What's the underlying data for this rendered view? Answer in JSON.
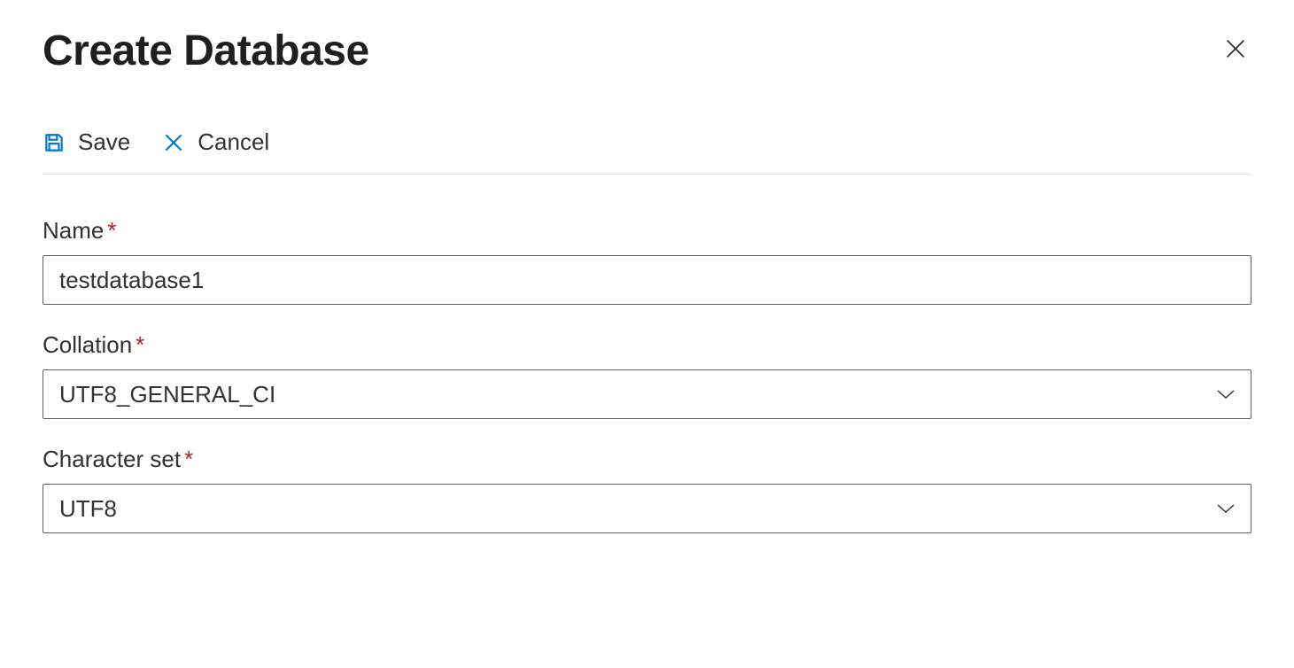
{
  "header": {
    "title": "Create Database"
  },
  "toolbar": {
    "save_label": "Save",
    "cancel_label": "Cancel"
  },
  "form": {
    "name": {
      "label": "Name",
      "value": "testdatabase1"
    },
    "collation": {
      "label": "Collation",
      "value": "UTF8_GENERAL_CI"
    },
    "charset": {
      "label": "Character set",
      "value": "UTF8"
    }
  }
}
